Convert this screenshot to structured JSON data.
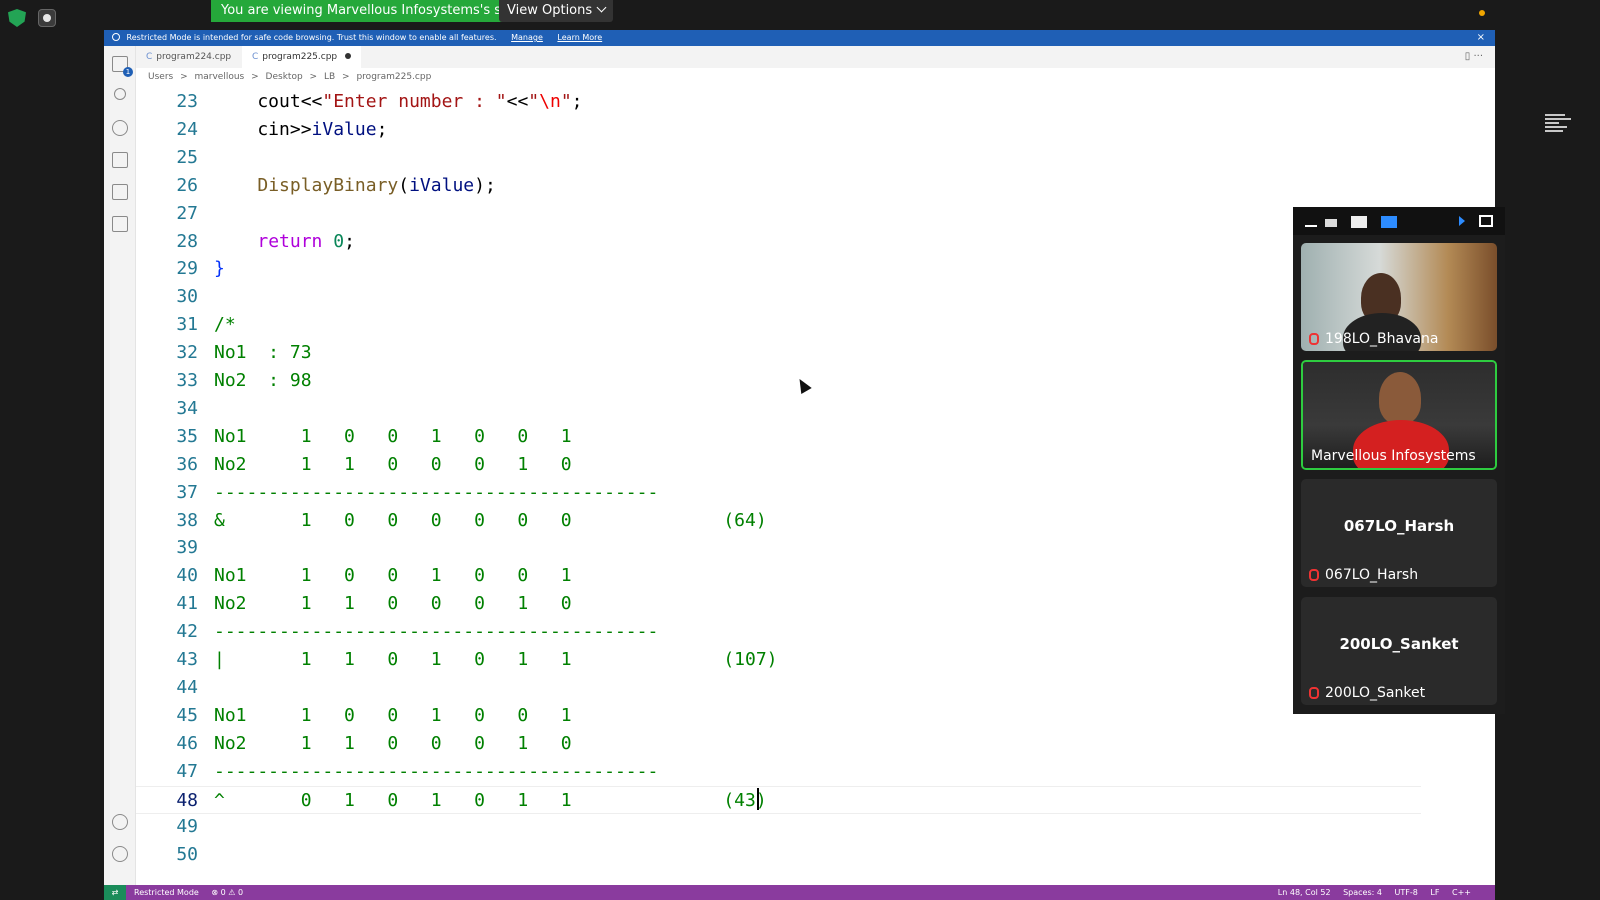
{
  "zoom": {
    "share_banner": "You are viewing Marvellous Infosystems's screen",
    "view_options": "View Options"
  },
  "vscode": {
    "restricted": {
      "message": "Restricted Mode is intended for safe code browsing. Trust this window to enable all features.",
      "manage": "Manage",
      "learn_more": "Learn More",
      "close": "×"
    },
    "tabs": [
      {
        "label": "program224.cpp",
        "icon": "C"
      },
      {
        "label": "program225.cpp",
        "icon": "C"
      }
    ],
    "breadcrumb": [
      "Users",
      ">",
      "marvellous",
      ">",
      "Desktop",
      ">",
      "LB",
      ">",
      "program225.cpp"
    ],
    "status": {
      "mode": "Restricted Mode",
      "problems": "⊗ 0 ⚠ 0",
      "position": "Ln 48, Col 52",
      "spaces": "Spaces: 4",
      "encoding": "UTF-8",
      "eol": "LF",
      "language": "C++"
    }
  },
  "code": {
    "current_line": 48,
    "lines": [
      {
        "n": "23",
        "text": "    cout<<\"Enter number : \"<<\"\\n\";"
      },
      {
        "n": "24",
        "text": "    cin>>iValue;"
      },
      {
        "n": "25",
        "text": ""
      },
      {
        "n": "26",
        "text": "    DisplayBinary(iValue);"
      },
      {
        "n": "27",
        "text": ""
      },
      {
        "n": "28",
        "text": "    return 0;"
      },
      {
        "n": "29",
        "text": "}"
      },
      {
        "n": "30",
        "text": ""
      },
      {
        "n": "31",
        "text": "/*"
      },
      {
        "n": "32",
        "text": "No1  : 73"
      },
      {
        "n": "33",
        "text": "No2  : 98"
      },
      {
        "n": "34",
        "text": ""
      },
      {
        "n": "35",
        "text": "No1     1   0   0   1   0   0   1"
      },
      {
        "n": "36",
        "text": "No2     1   1   0   0   0   1   0"
      },
      {
        "n": "37",
        "text": "-----------------------------------------"
      },
      {
        "n": "38",
        "text": "&       1   0   0   0   0   0   0              (64)"
      },
      {
        "n": "39",
        "text": ""
      },
      {
        "n": "40",
        "text": "No1     1   0   0   1   0   0   1"
      },
      {
        "n": "41",
        "text": "No2     1   1   0   0   0   1   0"
      },
      {
        "n": "42",
        "text": "-----------------------------------------"
      },
      {
        "n": "43",
        "text": "|       1   1   0   1   0   1   1              (107)"
      },
      {
        "n": "44",
        "text": ""
      },
      {
        "n": "45",
        "text": "No1     1   0   0   1   0   0   1"
      },
      {
        "n": "46",
        "text": "No2     1   1   0   0   0   1   0"
      },
      {
        "n": "47",
        "text": "-----------------------------------------"
      },
      {
        "n": "48",
        "text": "^       0   1   0   1   0   1   1              (43)"
      },
      {
        "n": "49",
        "text": ""
      },
      {
        "n": "50",
        "text": ""
      }
    ]
  },
  "participants": [
    {
      "name": "198LO_Bhavana",
      "video": true,
      "muted": true
    },
    {
      "name": "Marvellous Infosystems",
      "video": true,
      "muted": false,
      "speaking": true
    },
    {
      "name": "067LO_Harsh",
      "video": false,
      "muted": true
    },
    {
      "name": "200LO_Sanket",
      "video": false,
      "muted": true
    }
  ],
  "colors": {
    "share_green": "#25a83a",
    "vscode_blue": "#1f5fb5",
    "statusbar_purple": "#8a3b9e",
    "speaking_border": "#2ecc40"
  }
}
